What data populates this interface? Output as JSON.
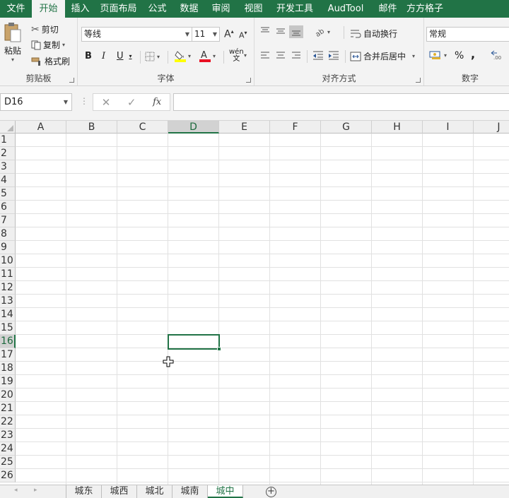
{
  "ribbon_tabs": [
    "文件",
    "开始",
    "插入",
    "页面布局",
    "公式",
    "数据",
    "审阅",
    "视图",
    "开发工具",
    "AudTool",
    "邮件",
    "方方格子"
  ],
  "active_tab": "开始",
  "clipboard": {
    "paste": "粘贴",
    "cut": "剪切",
    "copy": "复制",
    "format_painter": "格式刷",
    "label": "剪贴板"
  },
  "font": {
    "name": "等线",
    "size": "11",
    "bold": "B",
    "italic": "I",
    "underline": "U",
    "label": "字体",
    "phonetic_top": "wén",
    "phonetic_bottom": "文"
  },
  "alignment": {
    "wrap": "自动换行",
    "merge": "合并后居中",
    "label": "对齐方式"
  },
  "number": {
    "format": "常规",
    "percent": "%",
    "comma": ",",
    "label": "数字"
  },
  "formula_bar": {
    "name_box": "D16",
    "separator": "⋮",
    "cancel": "✕",
    "enter": "✓",
    "fx": "fx",
    "value": ""
  },
  "columns": [
    "A",
    "B",
    "C",
    "D",
    "E",
    "F",
    "G",
    "H",
    "I",
    "J"
  ],
  "rows": [
    "1",
    "2",
    "3",
    "4",
    "5",
    "6",
    "7",
    "8",
    "9",
    "10",
    "11",
    "12",
    "13",
    "14",
    "15",
    "16",
    "17",
    "18",
    "19",
    "20",
    "21",
    "22",
    "23",
    "24",
    "25",
    "26"
  ],
  "selected_cell": {
    "column": "D",
    "row": "16"
  },
  "sheets": [
    "城东",
    "城西",
    "城北",
    "城南",
    "城中"
  ],
  "active_sheet": "城中",
  "add_sheet": "+",
  "colors": {
    "accent": "#217346",
    "font_color": "#e81123",
    "highlight": "#ffff00"
  }
}
